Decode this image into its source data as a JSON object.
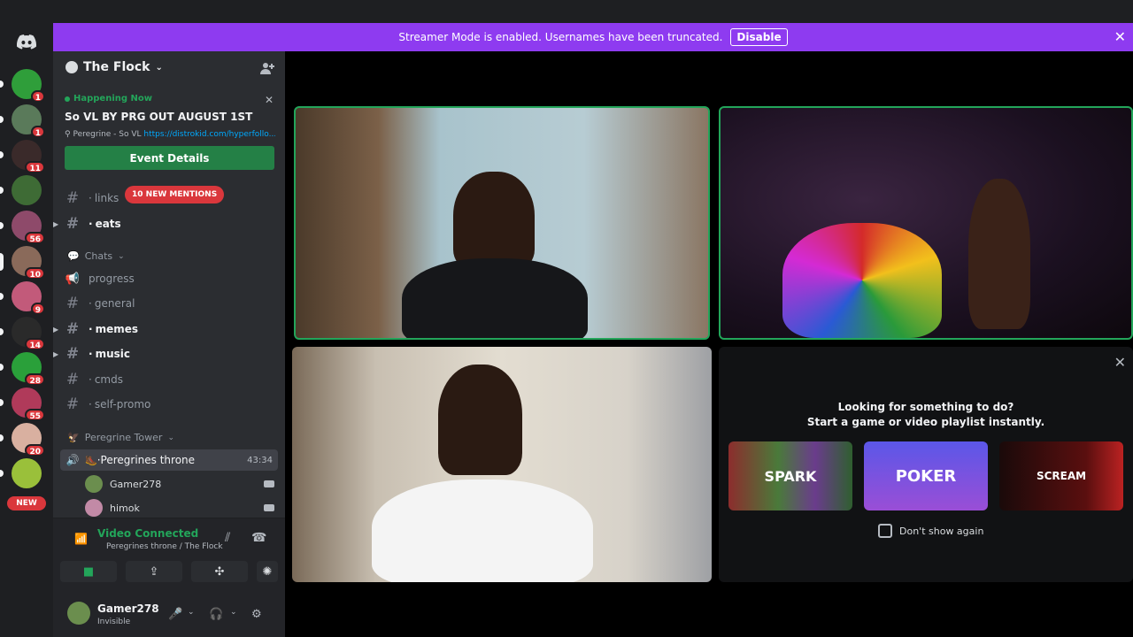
{
  "streamer_bar": {
    "message": "Streamer Mode is enabled. Usernames have been truncated.",
    "disable_label": "Disable"
  },
  "rail": {
    "badges": [
      "1",
      "1",
      "11",
      "",
      "56",
      "10",
      "9",
      "14",
      "28",
      "55",
      "20",
      ""
    ],
    "new_label": "NEW"
  },
  "guild": {
    "name": "The Flock"
  },
  "event": {
    "status": "Happening Now",
    "title": "So VL BY PRG OUT AUGUST 1ST",
    "location_prefix": "Peregrine - So VL",
    "location_link": "https://distrokid.com/hyperfollo...",
    "button_label": "Event Details"
  },
  "channels": {
    "links": "links",
    "mentions": "10 NEW MENTIONS",
    "eats": "eats",
    "cat_chats": "Chats",
    "progress": "progress",
    "general": "general",
    "memes": "memes",
    "music": "music",
    "cmds": "cmds",
    "self_promo": "self-promo",
    "cat_tower": "Peregrine Tower",
    "voice_channel": "Peregrines throne",
    "voice_timer": "43:34",
    "voice_users": [
      "Gamer278",
      "himok"
    ]
  },
  "voice_panel": {
    "status": "Video Connected",
    "location": "Peregrines throne / The Flock"
  },
  "user": {
    "name": "Gamer278",
    "status": "Invisible"
  },
  "suggestions": {
    "line1": "Looking for something to do?",
    "line2": "Start a game or video playlist instantly.",
    "cards": [
      "SPARK",
      "POKER",
      "SCREAM"
    ],
    "dont_show": "Don't show again"
  },
  "colors": {
    "accent": "#8e3bf0",
    "speaking": "#23a55a",
    "danger": "#da373c"
  }
}
